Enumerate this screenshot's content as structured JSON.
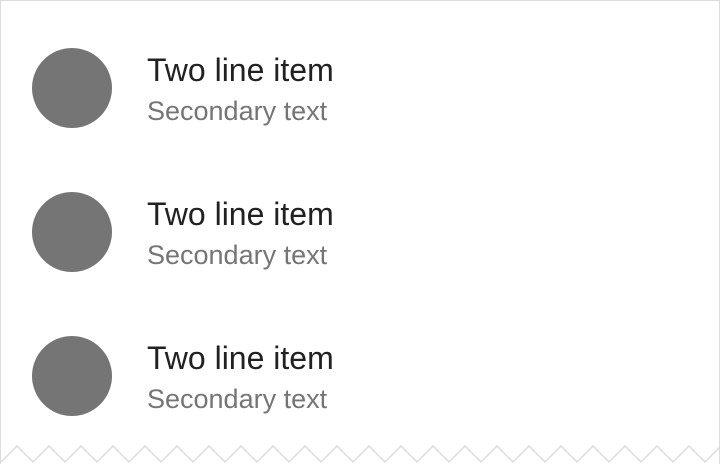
{
  "list": {
    "items": [
      {
        "primary": "Two line item",
        "secondary": "Secondary text",
        "avatar_icon": "avatar-circle"
      },
      {
        "primary": "Two line item",
        "secondary": "Secondary text",
        "avatar_icon": "avatar-circle"
      },
      {
        "primary": "Two line item",
        "secondary": "Secondary text",
        "avatar_icon": "avatar-circle"
      }
    ]
  },
  "colors": {
    "background": "#ffffff",
    "avatar": "#757575",
    "primary_text": "#212121",
    "secondary_text": "#757575",
    "border": "#dcdcdc"
  }
}
